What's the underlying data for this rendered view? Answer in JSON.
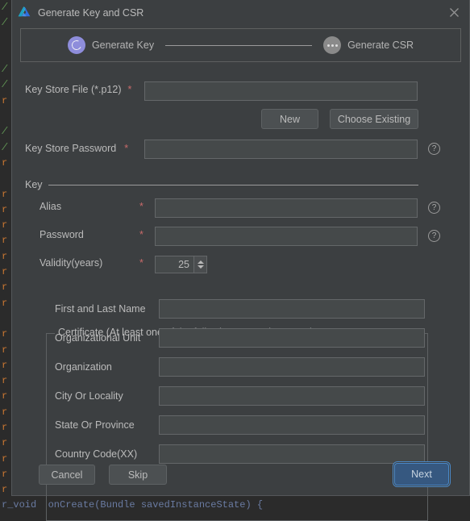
{
  "window": {
    "title": "Generate Key and CSR",
    "app_icon": "android-studio-icon",
    "close_icon": "close-icon"
  },
  "wizard": {
    "steps": [
      {
        "label": "Generate Key",
        "state": "active",
        "icon": "spinner-ring-icon"
      },
      {
        "label": "Generate CSR",
        "state": "pending",
        "icon": "ellipsis-icon"
      }
    ]
  },
  "form": {
    "key_store_file": {
      "label": "Key Store File (*.p12)",
      "required_marker": "*",
      "value": "",
      "placeholder": ""
    },
    "new_button": "New",
    "choose_existing_button": "Choose Existing",
    "key_store_password": {
      "label": "Key Store Password",
      "required_marker": "*",
      "value": "",
      "help_icon": "help-icon"
    },
    "key_section": {
      "title": "Key",
      "alias": {
        "label": "Alias",
        "required_marker": "*",
        "value": "",
        "help_icon": "help-icon"
      },
      "password": {
        "label": "Password",
        "required_marker": "*",
        "value": "",
        "help_icon": "help-icon"
      },
      "validity": {
        "label": "Validity(years)",
        "required_marker": "*",
        "value": "25"
      }
    },
    "certificate_section": {
      "title": "Certificate (At least one of the following cannot be empty)",
      "fields": [
        {
          "label": "First and Last Name",
          "value": ""
        },
        {
          "label": "Organizational Unit",
          "value": ""
        },
        {
          "label": "Organization",
          "value": ""
        },
        {
          "label": "City Or Locality",
          "value": ""
        },
        {
          "label": "State Or Province",
          "value": ""
        },
        {
          "label": "Country Code(XX)",
          "value": ""
        }
      ]
    }
  },
  "footer": {
    "cancel_label": "Cancel",
    "skip_label": "Skip",
    "next_label": "Next"
  },
  "colors": {
    "dialog_background": "#3c3f41",
    "input_background": "#45494a",
    "input_border": "#646769",
    "text": "#bbbbbb",
    "required_asterisk": "#c86a6a",
    "step_active": "#8e8ddb",
    "step_pending": "#8a8a8a",
    "primary_button": "#365880",
    "primary_button_focus": "#4a88c7",
    "editor_background": "#2b2b2b"
  },
  "background_editor": {
    "lines": [
      "/",
      "/",
      "",
      "",
      "/",
      "/",
      "r",
      "",
      "/",
      "/",
      "r",
      "",
      "r",
      "r",
      "r",
      "r",
      "r",
      "r",
      "r",
      "r",
      "",
      "r",
      "r",
      "r"
    ],
    "bottom_line": "r_void  onCreate(Bundle savedInstanceState) {"
  }
}
